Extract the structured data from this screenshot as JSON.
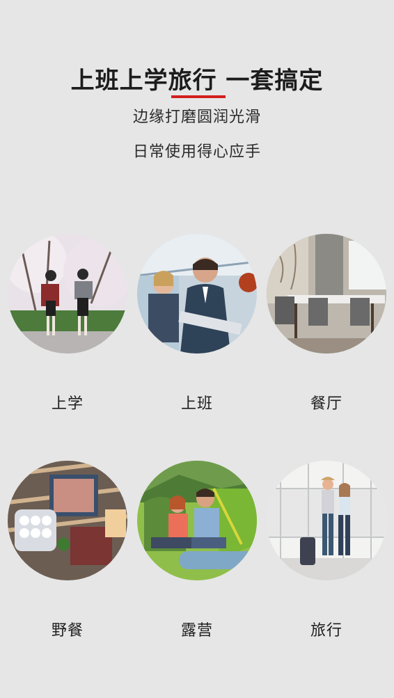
{
  "header": {
    "title": "上班上学旅行 一套搞定",
    "line1": "边缘打磨圆润光滑",
    "line2": "日常使用得心应手",
    "accent": "#d21e1e"
  },
  "scenes": [
    {
      "label": "上学",
      "icon": "school-photo"
    },
    {
      "label": "上班",
      "icon": "office-photo"
    },
    {
      "label": "餐厅",
      "icon": "restaurant-photo"
    },
    {
      "label": "野餐",
      "icon": "picnic-photo"
    },
    {
      "label": "露营",
      "icon": "camping-photo"
    },
    {
      "label": "旅行",
      "icon": "travel-photo"
    }
  ]
}
